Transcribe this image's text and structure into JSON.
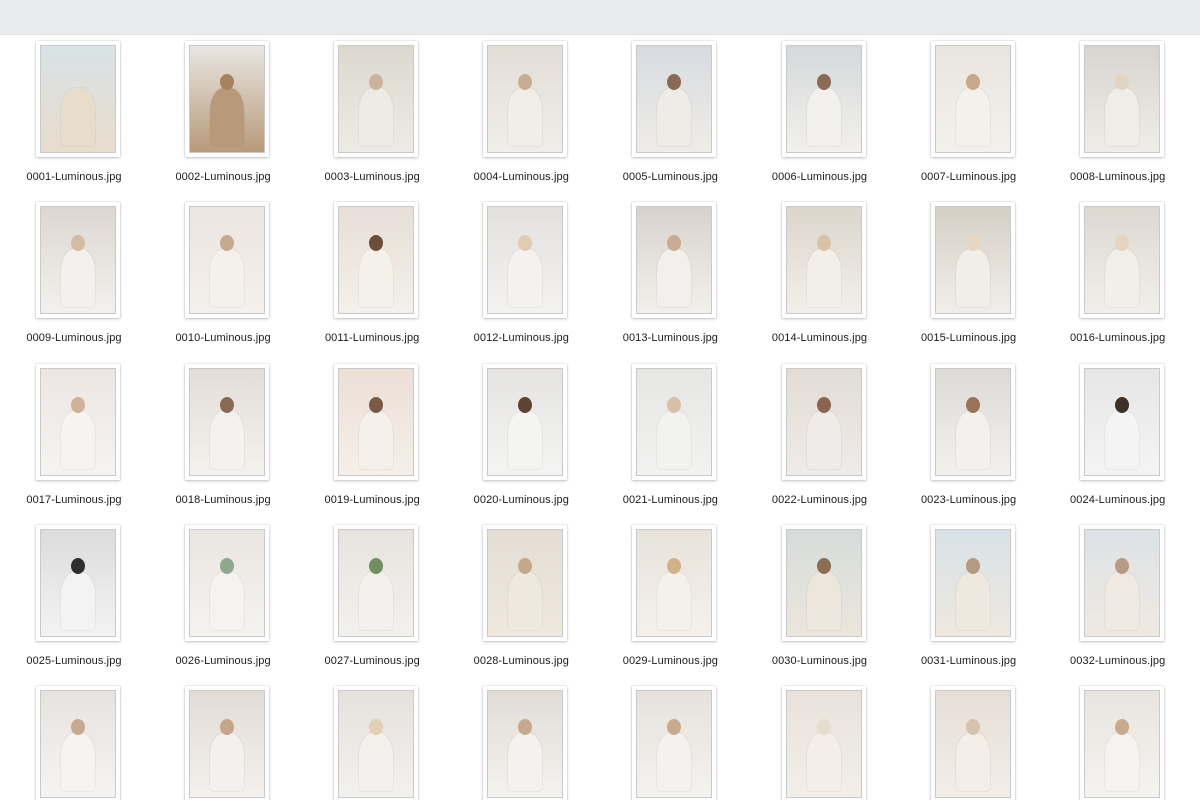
{
  "files": [
    {
      "name": "0001-Luminous.jpg",
      "bg": "#d9e2e6",
      "fg": "#e8dccc",
      "skin": null
    },
    {
      "name": "0002-Luminous.jpg",
      "bg": "#e9e6e2",
      "fg": "#b89a7a",
      "skin": "#a7825f"
    },
    {
      "name": "0003-Luminous.jpg",
      "bg": "#dcd8d0",
      "fg": "#ecebe4",
      "skin": "#cdb39a"
    },
    {
      "name": "0004-Luminous.jpg",
      "bg": "#e2ddd6",
      "fg": "#f0eee9",
      "skin": "#c9ad93"
    },
    {
      "name": "0005-Luminous.jpg",
      "bg": "#d7dbe0",
      "fg": "#efece7",
      "skin": "#8a6a52"
    },
    {
      "name": "0006-Luminous.jpg",
      "bg": "#d5d9db",
      "fg": "#f2f0ec",
      "skin": "#8b6a55"
    },
    {
      "name": "0007-Luminous.jpg",
      "bg": "#e9e4de",
      "fg": "#f3f1ec",
      "skin": "#c7a88b"
    },
    {
      "name": "0008-Luminous.jpg",
      "bg": "#d8d4cf",
      "fg": "#efede8",
      "skin": "#e2d4c2"
    },
    {
      "name": "0009-Luminous.jpg",
      "bg": "#dcd6cf",
      "fg": "#f3f1ee",
      "skin": "#d3bca2"
    },
    {
      "name": "0010-Luminous.jpg",
      "bg": "#ece5e1",
      "fg": "#f4f0ec",
      "skin": "#c7a98d"
    },
    {
      "name": "0011-Luminous.jpg",
      "bg": "#e7dfd7",
      "fg": "#f4f0ea",
      "skin": "#6b4f3c"
    },
    {
      "name": "0012-Luminous.jpg",
      "bg": "#e3e1de",
      "fg": "#f3f2f0",
      "skin": "#e0ccb1"
    },
    {
      "name": "0013-Luminous.jpg",
      "bg": "#d8d2cd",
      "fg": "#f2f0ec",
      "skin": "#c9ab93"
    },
    {
      "name": "0014-Luminous.jpg",
      "bg": "#dcd5cc",
      "fg": "#f2efea",
      "skin": "#d8c2a6"
    },
    {
      "name": "0015-Luminous.jpg",
      "bg": "#d5cfc6",
      "fg": "#f1eee9",
      "skin": "#e7d7c0"
    },
    {
      "name": "0016-Luminous.jpg",
      "bg": "#ddd8d1",
      "fg": "#f1efea",
      "skin": "#e4d5c1"
    },
    {
      "name": "0017-Luminous.jpg",
      "bg": "#ece6e3",
      "fg": "#f6f3f0",
      "skin": "#cfb29a"
    },
    {
      "name": "0018-Luminous.jpg",
      "bg": "#e3ddd8",
      "fg": "#f4f2ee",
      "skin": "#8a6a55"
    },
    {
      "name": "0019-Luminous.jpg",
      "bg": "#ecdfd6",
      "fg": "#f5efe9",
      "skin": "#7a5a45"
    },
    {
      "name": "0020-Luminous.jpg",
      "bg": "#e5e4e2",
      "fg": "#f4f4f3",
      "skin": "#5c4333"
    },
    {
      "name": "0021-Luminous.jpg",
      "bg": "#e6e6e4",
      "fg": "#f2f2f1",
      "skin": "#d8c0a8"
    },
    {
      "name": "0022-Luminous.jpg",
      "bg": "#e3dcd6",
      "fg": "#efebe8",
      "skin": "#8a6550"
    },
    {
      "name": "0023-Luminous.jpg",
      "bg": "#dcdad6",
      "fg": "#f2f1ee",
      "skin": "#9a7259"
    },
    {
      "name": "0024-Luminous.jpg",
      "bg": "#e6e6e6",
      "fg": "#f4f4f4",
      "skin": "#3e2f28"
    },
    {
      "name": "0025-Luminous.jpg",
      "bg": "#dcdcdc",
      "fg": "#f3f3f3",
      "skin": "#2f2f2f"
    },
    {
      "name": "0026-Luminous.jpg",
      "bg": "#e9e5e1",
      "fg": "#f5f3f0",
      "skin": "#8fa88b"
    },
    {
      "name": "0027-Luminous.jpg",
      "bg": "#e7e4df",
      "fg": "#f3f1ed",
      "skin": "#6f8f63"
    },
    {
      "name": "0028-Luminous.jpg",
      "bg": "#e4ddd4",
      "fg": "#efe8dd",
      "skin": "#c2a98c"
    },
    {
      "name": "0029-Luminous.jpg",
      "bg": "#e8e2da",
      "fg": "#f4f1ec",
      "skin": "#d3b28a"
    },
    {
      "name": "0030-Luminous.jpg",
      "bg": "#d6dcdb",
      "fg": "#ece6dc",
      "skin": "#8c6d55"
    },
    {
      "name": "0031-Luminous.jpg",
      "bg": "#d8e2e8",
      "fg": "#efe8df",
      "skin": "#b49a80"
    },
    {
      "name": "0032-Luminous.jpg",
      "bg": "#dde2e6",
      "fg": "#efe9e2",
      "skin": "#b89b82"
    },
    {
      "name": "",
      "bg": "#e6e3df",
      "fg": "#f5f4f2",
      "skin": "#c9a98d"
    },
    {
      "name": "",
      "bg": "#e2dcd6",
      "fg": "#f3f0ed",
      "skin": "#c6a68a"
    },
    {
      "name": "",
      "bg": "#e5e2dd",
      "fg": "#f3f1ee",
      "skin": "#e3d0b5"
    },
    {
      "name": "",
      "bg": "#e1dcd6",
      "fg": "#f4f2ef",
      "skin": "#c7a88e"
    },
    {
      "name": "",
      "bg": "#e6e1dc",
      "fg": "#f4f2ef",
      "skin": "#c9aa8e"
    },
    {
      "name": "",
      "bg": "#e9e2dc",
      "fg": "#f3eeea",
      "skin": "#e6dcd0"
    },
    {
      "name": "",
      "bg": "#e6ded7",
      "fg": "#f3eee8",
      "skin": "#d6c3ad"
    },
    {
      "name": "",
      "bg": "#e8e4df",
      "fg": "#f5f3f0",
      "skin": "#c9aa8e"
    }
  ]
}
